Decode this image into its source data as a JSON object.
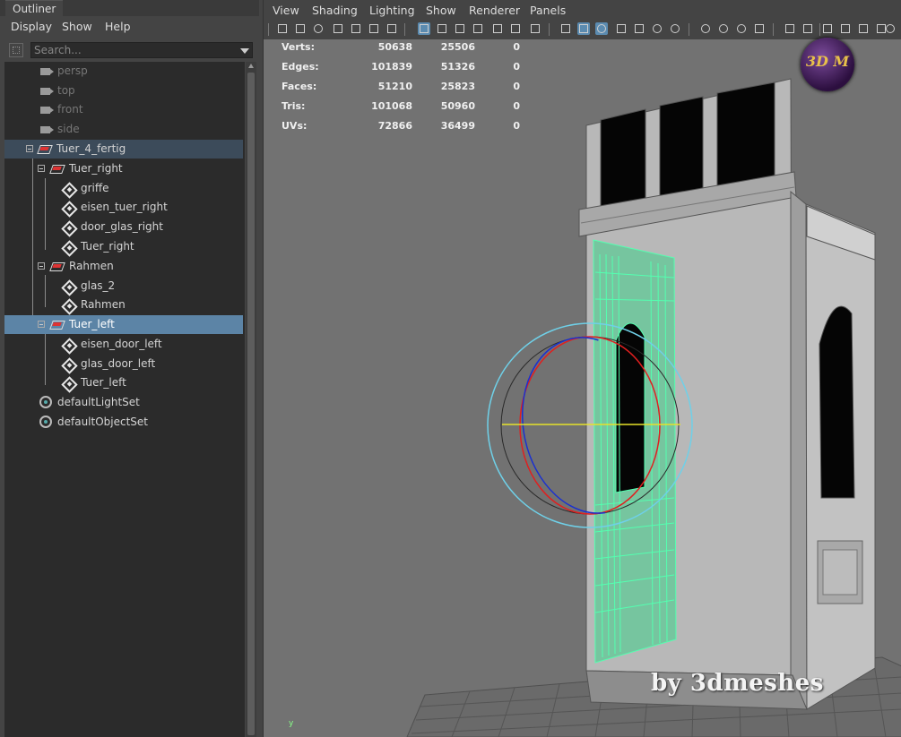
{
  "outliner": {
    "tab_label": "Outliner",
    "menu": [
      "Display",
      "Show",
      "Help"
    ],
    "search_placeholder": "Search...",
    "items": [
      {
        "label": "persp",
        "icon": "camera-icon"
      },
      {
        "label": "top",
        "icon": "camera-icon"
      },
      {
        "label": "front",
        "icon": "camera-icon"
      },
      {
        "label": "side",
        "icon": "camera-icon"
      },
      {
        "label": "Tuer_4_fertig",
        "icon": "group-icon"
      },
      {
        "label": "Tuer_right",
        "icon": "group-icon"
      },
      {
        "label": "griffe",
        "icon": "mesh-icon"
      },
      {
        "label": "eisen_tuer_right",
        "icon": "mesh-icon"
      },
      {
        "label": "door_glas_right",
        "icon": "mesh-icon"
      },
      {
        "label": "Tuer_right",
        "icon": "mesh-icon"
      },
      {
        "label": "Rahmen",
        "icon": "group-icon"
      },
      {
        "label": "glas_2",
        "icon": "mesh-icon"
      },
      {
        "label": "Rahmen",
        "icon": "mesh-icon"
      },
      {
        "label": "Tuer_left",
        "icon": "group-icon"
      },
      {
        "label": "eisen_door_left",
        "icon": "mesh-icon"
      },
      {
        "label": "glas_door_left",
        "icon": "mesh-icon"
      },
      {
        "label": "Tuer_left",
        "icon": "mesh-icon"
      },
      {
        "label": "defaultLightSet",
        "icon": "set-icon"
      },
      {
        "label": "defaultObjectSet",
        "icon": "set-icon"
      }
    ],
    "selected_item": "Tuer_left"
  },
  "viewport": {
    "menu": [
      "View",
      "Shading",
      "Lighting",
      "Show",
      "Renderer",
      "Panels"
    ],
    "hud": [
      {
        "label": "Verts:",
        "values": [
          "50638",
          "25506",
          "0"
        ]
      },
      {
        "label": "Edges:",
        "values": [
          "101839",
          "51326",
          "0"
        ]
      },
      {
        "label": "Faces:",
        "values": [
          "51210",
          "25823",
          "0"
        ]
      },
      {
        "label": "Tris:",
        "values": [
          "101068",
          "50960",
          "0"
        ]
      },
      {
        "label": "UVs:",
        "values": [
          "72866",
          "36499",
          "0"
        ]
      }
    ],
    "logo_text": "3D M",
    "watermark": "by 3dmeshes",
    "axis_label": "y"
  },
  "colors": {
    "selection": "#5c84a6",
    "wireframe": "#54ffb0",
    "viewport_bg": "#727272"
  }
}
